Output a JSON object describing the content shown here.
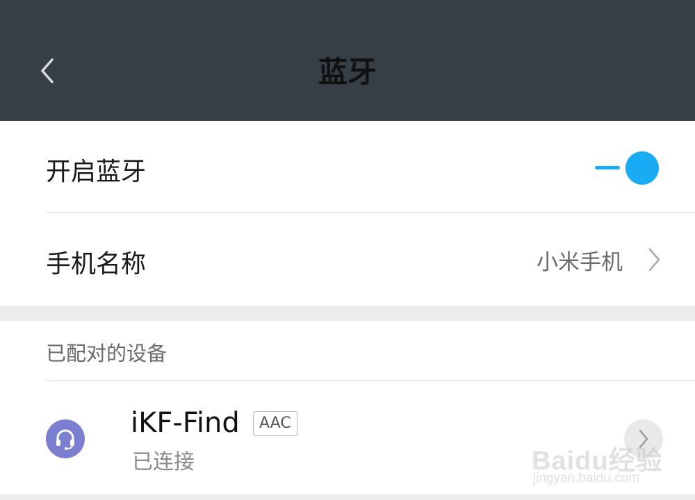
{
  "header": {
    "title": "蓝牙"
  },
  "bluetooth_toggle": {
    "label": "开启蓝牙",
    "enabled": true,
    "accent_color": "#1aabf5"
  },
  "phone_name": {
    "label": "手机名称",
    "value": "小米手机"
  },
  "paired_section": {
    "title": "已配对的设备",
    "devices": [
      {
        "name": "iKF-Find",
        "codec": "AAC",
        "status": "已连接",
        "icon": "headset-icon",
        "icon_color": "#7b7fd0"
      }
    ]
  },
  "watermark": {
    "logo": "Baidu经验",
    "url": "jingyan.baidu.com"
  },
  "colors": {
    "header_bg": "#363e46",
    "section_gap": "#ececec"
  }
}
